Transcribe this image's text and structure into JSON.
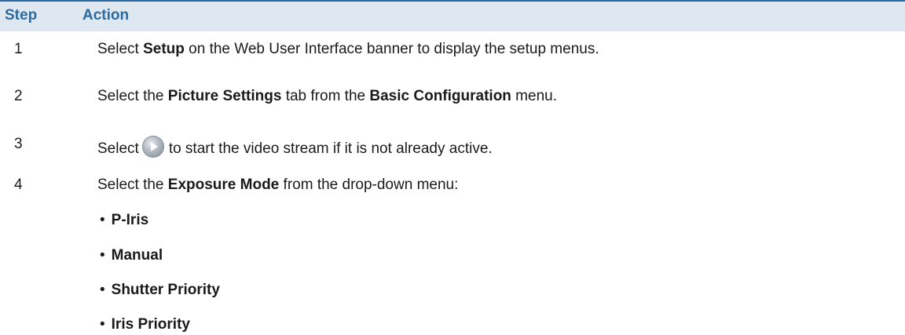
{
  "header": {
    "step": "Step",
    "action": "Action"
  },
  "steps": [
    {
      "num": "1",
      "pre": "Select ",
      "b1": "Setup",
      "post": " on the Web User Interface banner to display the setup menus."
    },
    {
      "num": "2",
      "pre": "Select the ",
      "b1": "Picture Settings",
      "mid": " tab from the ",
      "b2": "Basic Configuration",
      "post": " menu."
    },
    {
      "num": "3",
      "pre": "Select",
      "icon": "play-button-icon",
      "post": "to start the video stream if it is not already active."
    },
    {
      "num": "4",
      "pre": "Select the ",
      "b1": "Exposure Mode",
      "post": " from the drop-down menu:"
    }
  ],
  "bullet_char": "•",
  "exposure_modes": [
    "P-Iris",
    "Manual",
    "Shutter Priority",
    "Iris Priority"
  ],
  "colors": {
    "header_text": "#2b6aa0",
    "header_bg": "#dfe8f1",
    "rule": "#2b6aa0"
  }
}
